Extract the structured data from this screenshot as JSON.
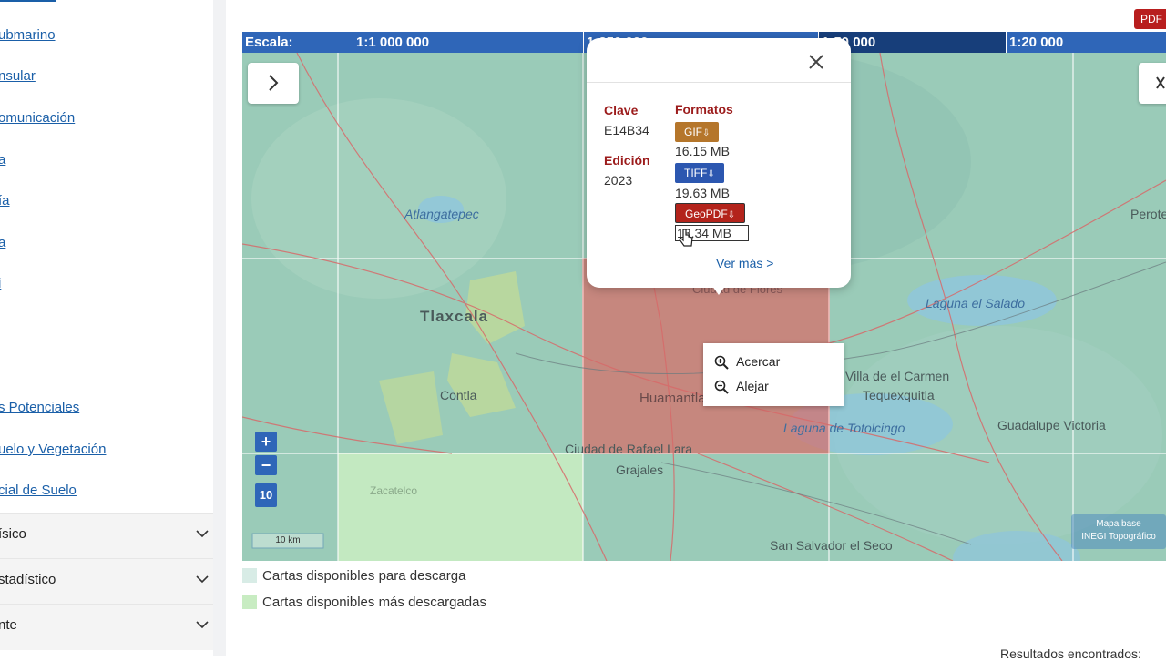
{
  "sidebar": {
    "links": [
      {
        "label": "ubmarino"
      },
      {
        "label": "nsular"
      },
      {
        "label": "omunicación"
      },
      {
        "label": "a"
      },
      {
        "label": "ía"
      },
      {
        "label": "a"
      },
      {
        "label": "i"
      },
      {
        "label": "s Potenciales"
      },
      {
        "label": "uelo y Vegetación"
      },
      {
        "label": "cial de Suelo"
      }
    ],
    "categories": [
      {
        "label": "ísico"
      },
      {
        "label": "stadístico"
      },
      {
        "label": "nte"
      }
    ]
  },
  "toolbar": {
    "pdf_label": "PDF"
  },
  "scale": {
    "label": "Escala:",
    "levels": [
      "1:1 000 000",
      "1:250 000",
      "1:50 000",
      "1:20 000"
    ]
  },
  "map": {
    "places": [
      "Tlaxcala",
      "Atlangatepec",
      "Contla",
      "Huamantla",
      "Ciudad de Rafael Lara",
      "Grajales",
      "Zacatelco",
      "Laguna el Salado",
      "Villa de el Carmen",
      "Tequexquitla",
      "Laguna de Totolcingo",
      "Guadalupe Victoria",
      "San Salvador el Seco",
      "Perote",
      "Ciudad de Flores"
    ],
    "zoom_level": "10",
    "scale_text": "10 km",
    "basemap_label_1": "Mapa base",
    "basemap_label_2": "INEGI Topográfico",
    "expand_icon": "chevron-right-icon",
    "colors": {
      "selected": "#e45a57",
      "available": "#c8ecc2",
      "scale_bar": "#2f66b8"
    }
  },
  "popup": {
    "clave_label": "Clave",
    "clave_value": "E14B34",
    "edicion_label": "Edición",
    "edicion_value": "2023",
    "formatos_label": "Formatos",
    "formats": [
      {
        "label": "GIF",
        "size": "16.15 MB",
        "color": "#b5762b"
      },
      {
        "label": "TIFF",
        "size": "19.63 MB",
        "color": "#2c57b0"
      },
      {
        "label": "GeoPDF",
        "size": "13.34 MB",
        "color": "#b3231b"
      }
    ],
    "more_link": "Ver más >"
  },
  "context_menu": {
    "zoom_in": "Acercar",
    "zoom_out": "Alejar"
  },
  "legend": [
    {
      "label": "Cartas disponibles para descarga",
      "color": "#d8ece6"
    },
    {
      "label": "Cartas disponibles más descargadas",
      "color": "#c8ecc2"
    }
  ],
  "results_label": "Resultados encontrados:"
}
